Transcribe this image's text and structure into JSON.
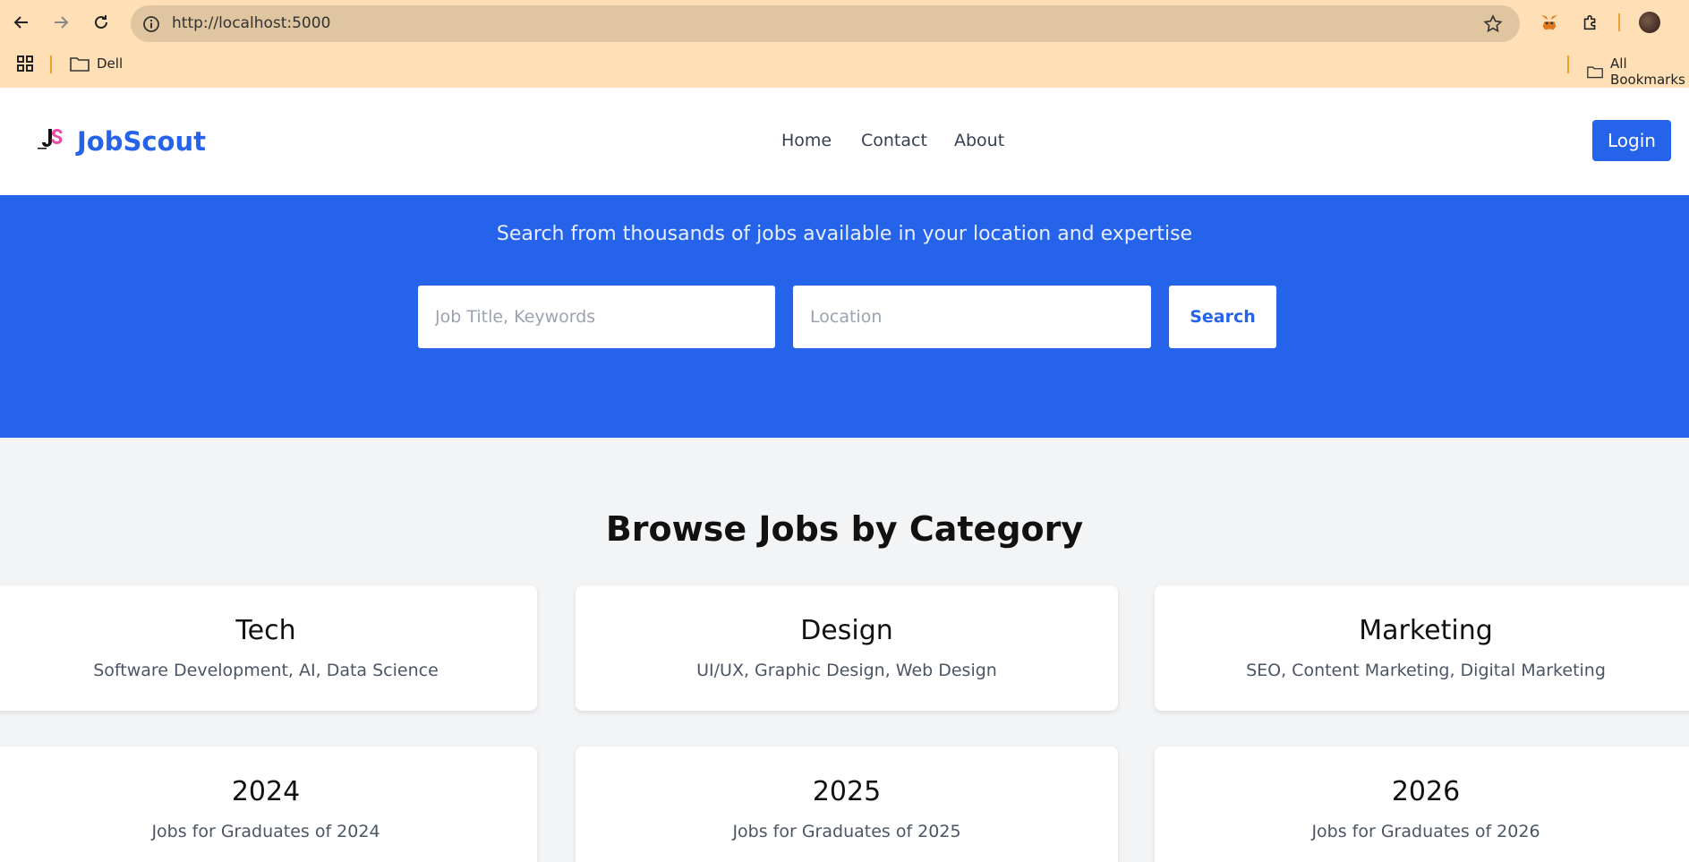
{
  "browser": {
    "url": "http://localhost:5000",
    "bookmarks": [
      {
        "label": "Dell"
      },
      {
        "label": "All Bookmarks"
      }
    ]
  },
  "site": {
    "brand": "JobScout",
    "nav": [
      "Home",
      "Contact",
      "About"
    ],
    "login_label": "Login"
  },
  "hero": {
    "subtitle": "Search from thousands of jobs available in your location and expertise",
    "keyword_placeholder": "Job Title, Keywords",
    "location_placeholder": "Location",
    "search_label": "Search"
  },
  "categories": {
    "title": "Browse Jobs by Category",
    "cards": [
      {
        "title": "Tech",
        "desc": "Software Development, AI, Data Science"
      },
      {
        "title": "Design",
        "desc": "UI/UX, Graphic Design, Web Design"
      },
      {
        "title": "Marketing",
        "desc": "SEO, Content Marketing, Digital Marketing"
      },
      {
        "title": "2024",
        "desc": "Jobs for Graduates of 2024"
      },
      {
        "title": "2025",
        "desc": "Jobs for Graduates of 2025"
      },
      {
        "title": "2026",
        "desc": "Jobs for Graduates of 2026"
      }
    ]
  },
  "colors": {
    "brand": "#2563eb",
    "chrome": "#ffdfb5",
    "page_bg": "#f3f4f6"
  }
}
